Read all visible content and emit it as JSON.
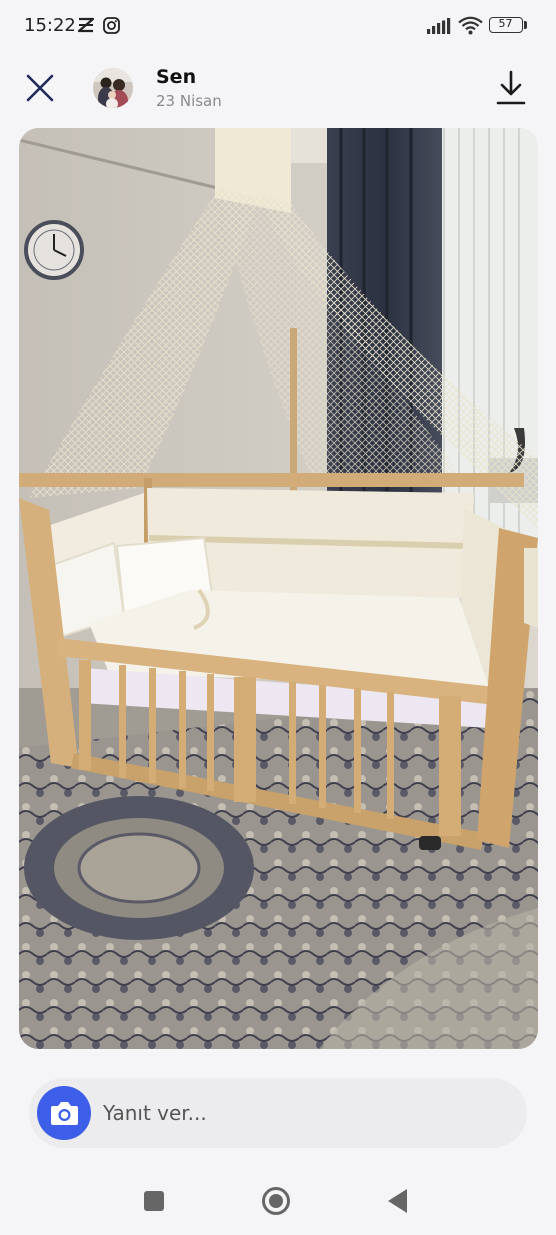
{
  "status_bar": {
    "time": "15:22",
    "battery": "57",
    "icons": [
      "capcut-icon",
      "instagram-icon",
      "signal-icon",
      "wifi-icon",
      "battery-icon"
    ]
  },
  "story": {
    "user_name": "Sen",
    "date": "23 Nisan"
  },
  "reply": {
    "placeholder": "Yanıt ver..."
  },
  "colors": {
    "accent": "#3d5ee8",
    "close_icon": "#1f2a5a"
  },
  "nav": [
    "recents-button",
    "home-button",
    "back-button"
  ]
}
